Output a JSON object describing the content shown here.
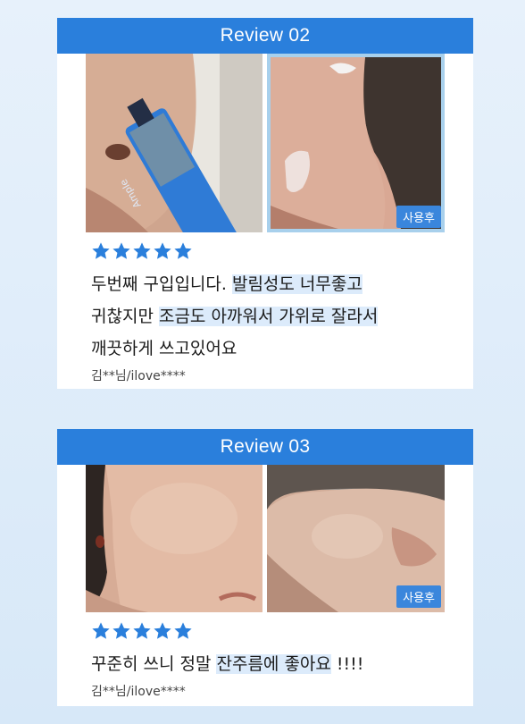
{
  "reviews": [
    {
      "header": "Review 02",
      "after_badge": "사용후",
      "rating": 5,
      "text_plain_1": "두번째 구입입니다. ",
      "text_hl_1": "발림성도 너무좋고",
      "text_plain_2": "귀찮지만 ",
      "text_hl_2": "조금도 아까워서 가위로 잘라서",
      "text_plain_3": "깨끗하게 쓰고있어요",
      "author": "김**님/ilove****"
    },
    {
      "header": "Review 03",
      "after_badge": "사용후",
      "rating": 5,
      "text_plain_1": "꾸준히 쓰니 정말 ",
      "text_hl_1": "잔주름에 좋아요",
      "text_plain_2": " !!!!",
      "author": "김**님/ilove****"
    }
  ],
  "tube_label": "Ample",
  "colors": {
    "accent": "#2a7fdc",
    "highlight": "#dcebfb",
    "star": "#2a7fdc"
  }
}
